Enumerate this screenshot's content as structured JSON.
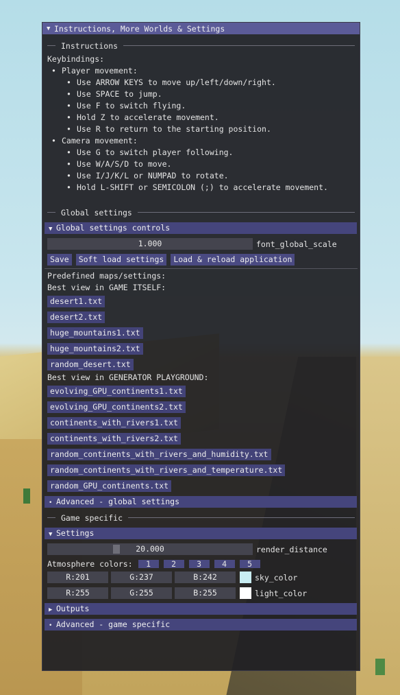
{
  "window": {
    "title": "Instructions, More Worlds & Settings"
  },
  "instructions": {
    "heading": "Instructions",
    "keybindings_label": "Keybindings:",
    "player_label": "Player movement:",
    "player_items": [
      "Use ARROW KEYS to move up/left/down/right.",
      "Use SPACE to jump.",
      "Use F to switch flying.",
      "Hold Z to accelerate movement.",
      "Use R to return to the starting position."
    ],
    "camera_label": "Camera movement:",
    "camera_items": [
      "Use G to switch player following.",
      "Use W/A/S/D to move.",
      "Use I/J/K/L or NUMPAD to rotate.",
      "Hold L-SHIFT or SEMICOLON (;) to accelerate movement."
    ]
  },
  "global": {
    "heading": "Global settings",
    "controls_header": "Global settings controls",
    "font_scale_value": "1.000",
    "font_scale_label": "font_global_scale",
    "save_label": "Save",
    "soft_load_label": "Soft load settings",
    "reload_label": "Load & reload application",
    "predefined_label": "Predefined maps/settings:",
    "game_view_label": "Best view in GAME ITSELF:",
    "game_maps": [
      "desert1.txt",
      "desert2.txt",
      "huge_mountains1.txt",
      "huge_mountains2.txt",
      "random_desert.txt"
    ],
    "generator_view_label": "Best view in GENERATOR PLAYGROUND:",
    "generator_maps": [
      "evolving_GPU_continents1.txt",
      "evolving_GPU_continents2.txt",
      "continents_with_rivers1.txt",
      "continents_with_rivers2.txt",
      "random_continents_with_rivers_and_humidity.txt",
      "random_continents_with_rivers_and_temperature.txt",
      "random_GPU_continents.txt"
    ],
    "advanced_header": "Advanced - global settings"
  },
  "game": {
    "heading": "Game specific",
    "settings_header": "Settings",
    "render_distance_value": "20.000",
    "render_distance_fraction": 0.33,
    "render_distance_label": "render_distance",
    "atmosphere_label": "Atmosphere colors:",
    "atmosphere_buttons": [
      "1",
      "2",
      "3",
      "4",
      "5"
    ],
    "sky": {
      "r": "R:201",
      "g": "G:237",
      "b": "B:242",
      "label": "sky_color",
      "color": "#c9edf2"
    },
    "light": {
      "r": "R:255",
      "g": "G:255",
      "b": "B:255",
      "label": "light_color",
      "color": "#ffffff"
    },
    "outputs_header": "Outputs",
    "advanced_header": "Advanced - game specific"
  },
  "colors": {
    "title_bar": "#5b5b98",
    "header": "#45457c",
    "button": "#4a4a82",
    "frame": "#44444e"
  }
}
